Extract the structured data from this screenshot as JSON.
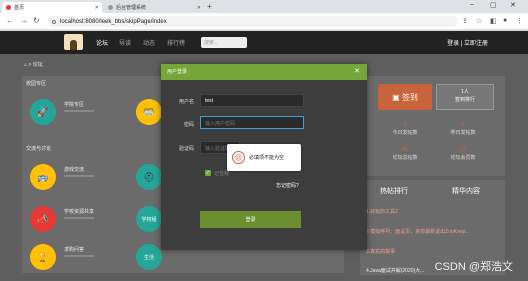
{
  "browser": {
    "tabs": [
      {
        "label": "首页"
      },
      {
        "label": "后台管理系统"
      }
    ],
    "url": "localhost:8080/leek_bbs/skipPage/index"
  },
  "nav": {
    "links": [
      "论坛",
      "导读",
      "动态",
      "排行榜"
    ],
    "search_placeholder": "搜索...",
    "right": "登录 | 立即注册"
  },
  "breadcrumb": "论坛",
  "sections": {
    "section1": "校园专区",
    "section2": "交流与讨论"
  },
  "boards": [
    {
      "name": "学院专区",
      "icon": "🚀",
      "color": "#26a69a"
    },
    {
      "name": "游戏交流",
      "icon": "🚌",
      "color": "#ffc107"
    },
    {
      "name": "学校资源共享",
      "icon": "📣",
      "color": "#e53935"
    },
    {
      "name": "求购问答",
      "icon": "🏆",
      "color": "#ffc107"
    }
  ],
  "boards_mid": [
    {
      "icon": "🥽",
      "color": "#ffc107"
    },
    {
      "icon": "⛑",
      "color": "#26a69a"
    },
    {
      "label": "学校组",
      "color": "#26a69a"
    },
    {
      "label": "生活",
      "color": "#26a69a"
    }
  ],
  "side": {
    "sign_label": "签到",
    "sign_count": "1人",
    "sign_rank": "签到排行",
    "stats": [
      {
        "n": "0",
        "l": "今日发帖数"
      },
      {
        "n": "1",
        "l": "昨日发帖数"
      },
      {
        "n": "41",
        "l": "论坛总帖数"
      },
      {
        "n": "23",
        "l": "论坛会员数"
      }
    ],
    "tab_hot": "热帖排行",
    "tab_good": "精华内容",
    "hot_items": [
      "1.好玩的工具2",
      "2.模拟序列：面试页，来你最新说出ZooKeep...",
      "3.真实的故事",
      "4.Java面试并解(2020)大..."
    ]
  },
  "modal": {
    "title": "用户登录",
    "username_label": "用户名",
    "username_value": "test",
    "password_label": "密码",
    "password_placeholder": "输入用户密码",
    "captcha_label": "验证码",
    "captcha_placeholder": "输入验证码",
    "remember": "记住我",
    "forgot": "忘记密码?",
    "login": "登录"
  },
  "tooltip": "必填项不能为空",
  "watermark": "CSDN @郑浩文"
}
